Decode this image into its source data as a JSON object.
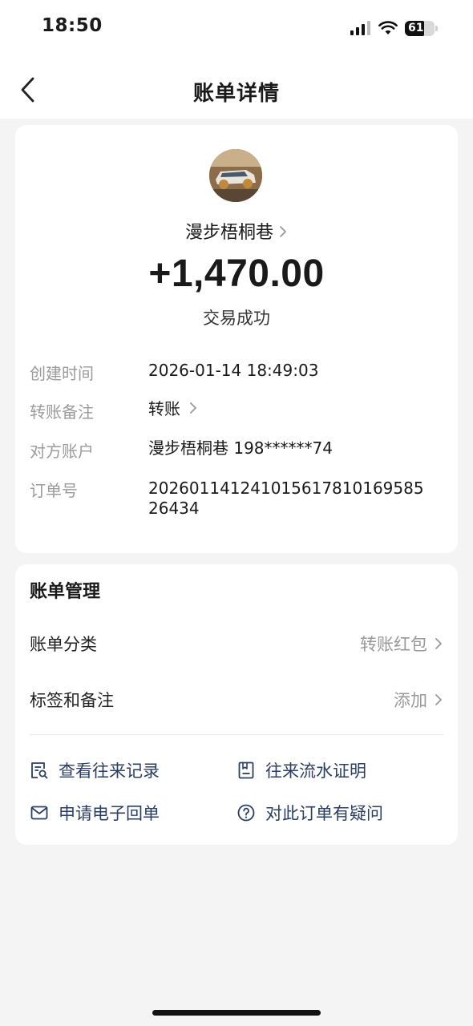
{
  "status_bar": {
    "time": "18:50",
    "battery_level": "61"
  },
  "nav": {
    "title": "账单详情"
  },
  "transaction": {
    "payee_name": "漫步梧桐巷",
    "amount": "+1,470.00",
    "status": "交易成功"
  },
  "details": [
    {
      "label": "创建时间",
      "value": "2026-01-14 18:49:03"
    },
    {
      "label": "转账备注",
      "value": "转账"
    },
    {
      "label": "对方账户",
      "value": "漫步梧桐巷 198******74"
    },
    {
      "label": "订单号",
      "value": "20260114124101561781016958526434"
    }
  ],
  "manage": {
    "title": "账单管理",
    "rows": [
      {
        "label": "账单分类",
        "value": "转账红包"
      },
      {
        "label": "标签和备注",
        "value": "添加"
      }
    ],
    "actions": [
      {
        "label": "查看往来记录",
        "icon": "record-search-icon"
      },
      {
        "label": "往来流水证明",
        "icon": "bookmark-doc-icon"
      },
      {
        "label": "申请电子回单",
        "icon": "mail-icon"
      },
      {
        "label": "对此订单有疑问",
        "icon": "question-icon"
      }
    ]
  },
  "colors": {
    "action_text": "#2b3f63",
    "label_grey": "#9b9b9b",
    "background": "#f4f4f4"
  }
}
